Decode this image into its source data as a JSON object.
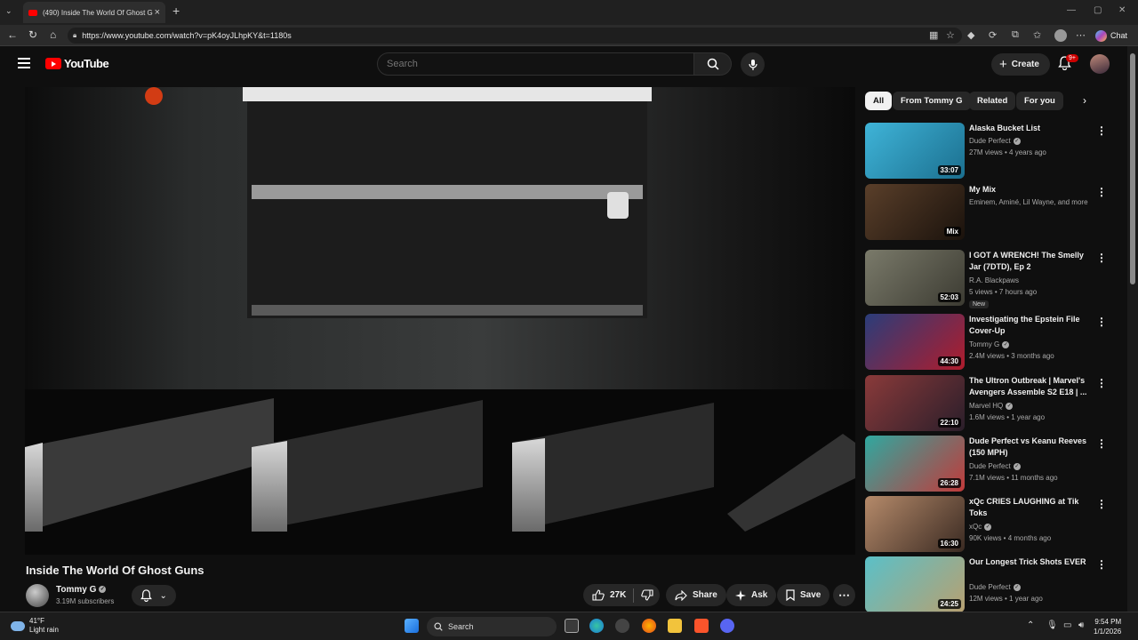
{
  "browser": {
    "tab_title": "(490) Inside The World Of Ghost G",
    "url": "https://www.youtube.com/watch?v=pK4oyJLhpKY&t=1180s",
    "chat_label": "Chat"
  },
  "header": {
    "logo_text": "YouTube",
    "search_placeholder": "Search",
    "create_label": "Create",
    "notif_badge": "9+"
  },
  "video": {
    "title": "Inside The World Of Ghost Guns",
    "channel": "Tommy G",
    "subscribers": "3.19M subscribers",
    "actions": {
      "likes": "27K",
      "share": "Share",
      "ask": "Ask",
      "save": "Save"
    }
  },
  "chips": [
    "All",
    "From Tommy G",
    "Related",
    "For you"
  ],
  "recommendations": [
    {
      "title": "Alaska Bucket List",
      "channel": "Dude Perfect",
      "verified": true,
      "meta": "27M views • 4 years ago",
      "duration": "33:07",
      "thumb_color": "#3fb4d8",
      "thumb_color2": "#1b6f8f"
    },
    {
      "title": "My Mix",
      "channel": "Eminem, Aminé, Lil Wayne, and more",
      "verified": false,
      "meta": "",
      "duration": "Mix",
      "thumb_color": "#5a3f2a",
      "thumb_color2": "#1a120c"
    },
    {
      "title": "I GOT A WRENCH!  The Smelly Jar (7DTD), Ep 2",
      "channel": "R.A. Blackpaws",
      "verified": false,
      "meta": "5 views • 7 hours ago",
      "badge": "New",
      "duration": "52:03",
      "thumb_color": "#7a7a6a",
      "thumb_color2": "#3c3b32"
    },
    {
      "title": "Investigating the Epstein File Cover-Up",
      "channel": "Tommy G",
      "verified": true,
      "meta": "2.4M views • 3 months ago",
      "duration": "44:30",
      "thumb_color": "#2a3d7a",
      "thumb_color2": "#b01c2c"
    },
    {
      "title": "The Ultron Outbreak | Marvel's Avengers Assemble S2 E18 | ...",
      "channel": "Marvel HQ",
      "verified": true,
      "meta": "1.6M views • 1 year ago",
      "duration": "22:10",
      "thumb_color": "#8a3a3a",
      "thumb_color2": "#2a1e2a"
    },
    {
      "title": "Dude Perfect vs Keanu Reeves (150 MPH)",
      "channel": "Dude Perfect",
      "verified": true,
      "meta": "7.1M views • 11 months ago",
      "duration": "26:28",
      "thumb_color": "#2fa8a0",
      "thumb_color2": "#c23a3a"
    },
    {
      "title": "xQc CRIES LAUGHING at Tik Toks",
      "channel": "xQc",
      "verified": true,
      "meta": "90K views • 4 months ago",
      "duration": "16:30",
      "thumb_color": "#b58a6a",
      "thumb_color2": "#3a2a22"
    },
    {
      "title": "Our Longest Trick Shots EVER",
      "channel": "Dude Perfect",
      "verified": true,
      "meta": "12M views • 1 year ago",
      "duration": "24:25",
      "thumb_color": "#5ac0c8",
      "thumb_color2": "#b8a070"
    }
  ],
  "taskbar": {
    "temp": "41°F",
    "weather": "Light rain",
    "search": "Search",
    "time": "9:54 PM",
    "date": "1/1/2026"
  }
}
